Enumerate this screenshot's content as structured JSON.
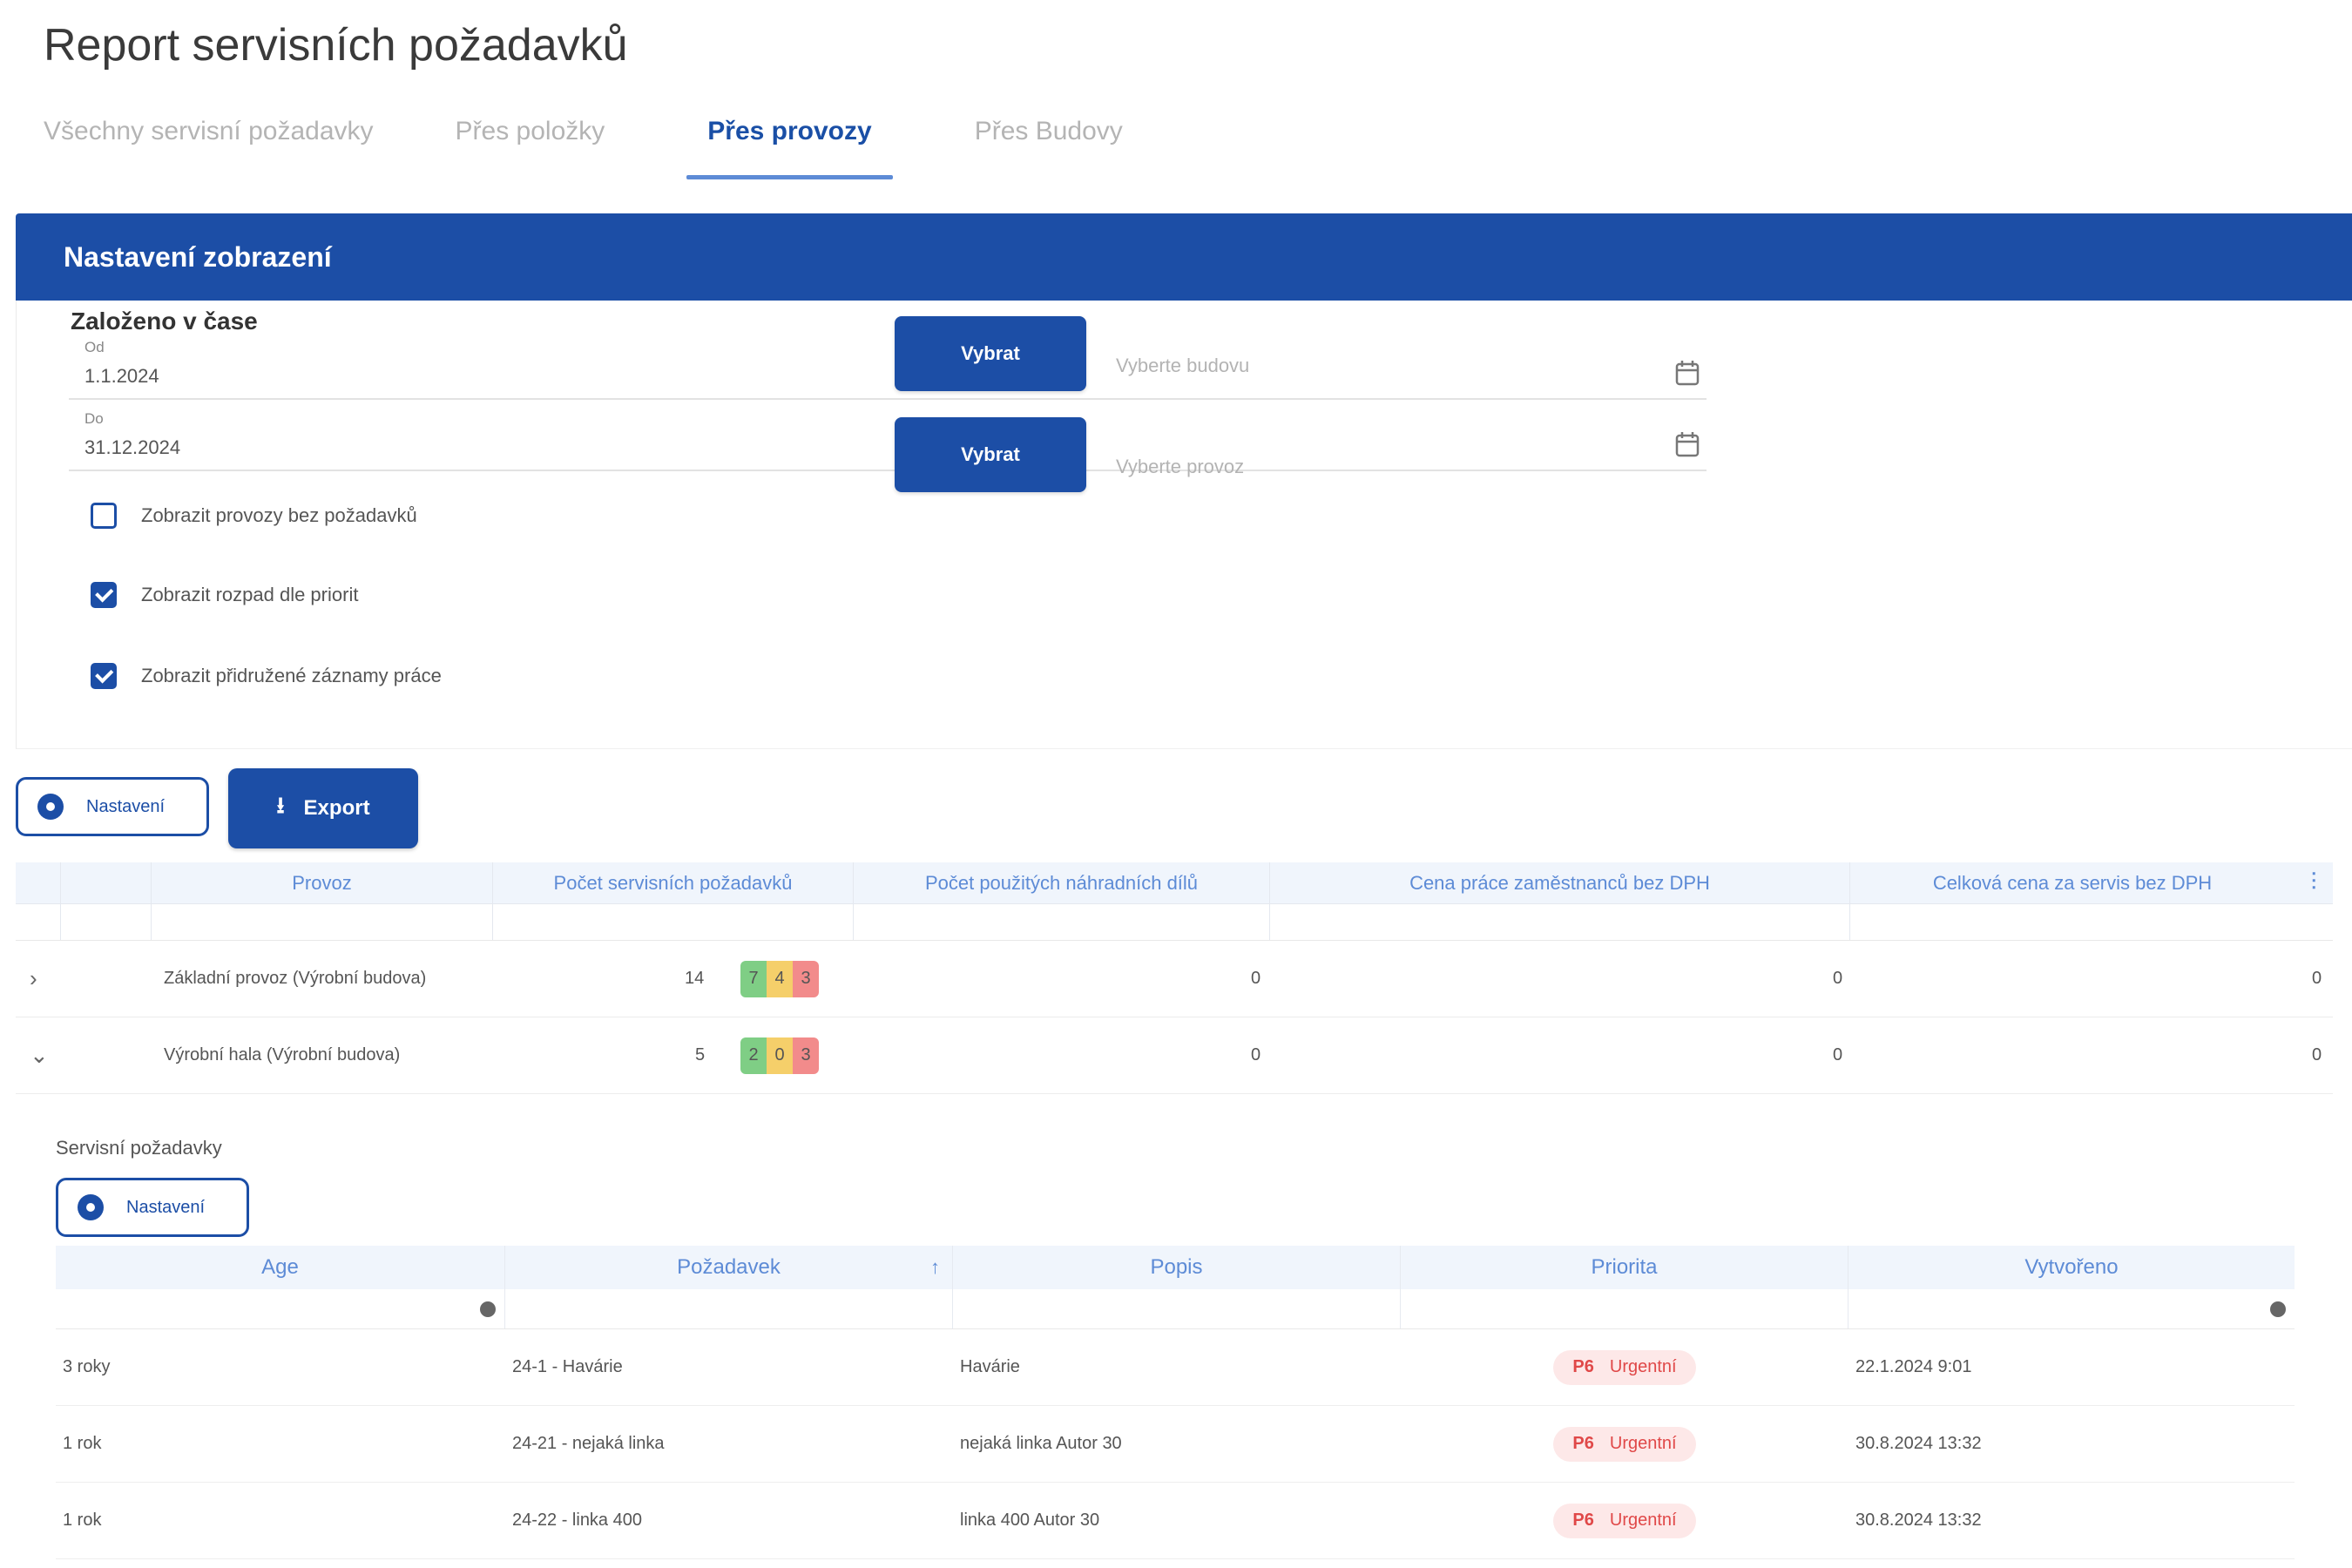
{
  "page": {
    "title": "Report servisních požadavků"
  },
  "tabs": [
    {
      "label": "Všechny servisní požadavky",
      "active": false
    },
    {
      "label": "Přes položky",
      "active": false
    },
    {
      "label": "Přes provozy",
      "active": true
    },
    {
      "label": "Přes Budovy",
      "active": false
    }
  ],
  "settings": {
    "header": "Nastavení zobrazení",
    "range_title": "Založeno v čase",
    "from_label": "Od",
    "from_value": "1.1.2024",
    "to_label": "Do",
    "to_value": "31.12.2024",
    "choose_building_button": "Vybrat",
    "choose_building_hint": "Vyberte budovu",
    "choose_operation_button": "Vybrat",
    "choose_operation_hint": "Vyberte provoz",
    "checkboxes": [
      {
        "label": "Zobrazit provozy bez požadavků",
        "checked": false
      },
      {
        "label": "Zobrazit rozpad dle priorit",
        "checked": true
      },
      {
        "label": "Zobrazit přidružené záznamy práce",
        "checked": true
      }
    ]
  },
  "toolbar": {
    "settings_label": "Nastavení",
    "export_label": "Export"
  },
  "grid": {
    "columns": [
      "Provoz",
      "Počet servisních požadavků",
      "Počet použitých náhradních dílů",
      "Cena práce zaměstnanců bez DPH",
      "Celková cena za servis bez DPH"
    ],
    "rows": [
      {
        "expander": "›",
        "name": "Základní provoz (Výrobní budova)",
        "count": "14",
        "priorities": [
          "7",
          "4",
          "3"
        ],
        "parts": "0",
        "labor": "0",
        "total": "0"
      },
      {
        "expander": "⌄",
        "name": "Výrobní hala (Výrobní budova)",
        "count": "5",
        "priorities": [
          "2",
          "0",
          "3"
        ],
        "parts": "0",
        "labor": "0",
        "total": "0"
      }
    ]
  },
  "sub": {
    "title": "Servisní požadavky",
    "settings_label": "Nastavení",
    "columns": [
      "Age",
      "Požadavek",
      "Popis",
      "Priorita",
      "Vytvořeno"
    ],
    "rows": [
      {
        "age": "3 roky",
        "request": "24-1 - Havárie",
        "desc": "Havárie",
        "prio_code": "P6",
        "prio_label": "Urgentní",
        "created": "22.1.2024 9:01"
      },
      {
        "age": "1 rok",
        "request": "24-21 - nejaká linka",
        "desc": "nejaká linka Autor 30",
        "prio_code": "P6",
        "prio_label": "Urgentní",
        "created": "30.8.2024 13:32"
      },
      {
        "age": "1 rok",
        "request": "24-22 - linka 400",
        "desc": "linka 400 Autor 30",
        "prio_code": "P6",
        "prio_label": "Urgentní",
        "created": "30.8.2024 13:32"
      }
    ]
  },
  "colors": {
    "primary": "#1c4ea6",
    "tab_active": "#1a4fa6",
    "header_text": "#5d8bd6",
    "urgent": "#e04848"
  }
}
